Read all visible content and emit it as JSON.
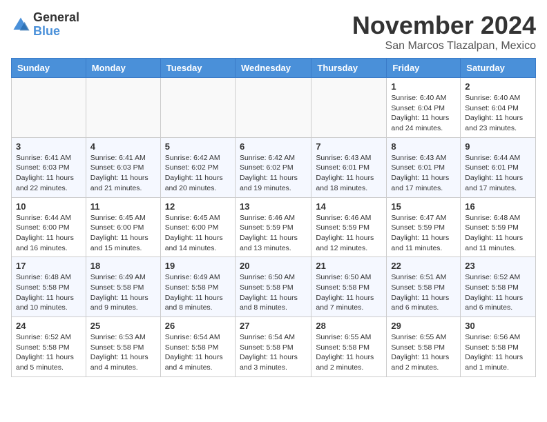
{
  "logo": {
    "general": "General",
    "blue": "Blue"
  },
  "title": "November 2024",
  "location": "San Marcos Tlazalpan, Mexico",
  "weekdays": [
    "Sunday",
    "Monday",
    "Tuesday",
    "Wednesday",
    "Thursday",
    "Friday",
    "Saturday"
  ],
  "weeks": [
    [
      {
        "day": "",
        "info": ""
      },
      {
        "day": "",
        "info": ""
      },
      {
        "day": "",
        "info": ""
      },
      {
        "day": "",
        "info": ""
      },
      {
        "day": "",
        "info": ""
      },
      {
        "day": "1",
        "info": "Sunrise: 6:40 AM\nSunset: 6:04 PM\nDaylight: 11 hours and 24 minutes."
      },
      {
        "day": "2",
        "info": "Sunrise: 6:40 AM\nSunset: 6:04 PM\nDaylight: 11 hours and 23 minutes."
      }
    ],
    [
      {
        "day": "3",
        "info": "Sunrise: 6:41 AM\nSunset: 6:03 PM\nDaylight: 11 hours and 22 minutes."
      },
      {
        "day": "4",
        "info": "Sunrise: 6:41 AM\nSunset: 6:03 PM\nDaylight: 11 hours and 21 minutes."
      },
      {
        "day": "5",
        "info": "Sunrise: 6:42 AM\nSunset: 6:02 PM\nDaylight: 11 hours and 20 minutes."
      },
      {
        "day": "6",
        "info": "Sunrise: 6:42 AM\nSunset: 6:02 PM\nDaylight: 11 hours and 19 minutes."
      },
      {
        "day": "7",
        "info": "Sunrise: 6:43 AM\nSunset: 6:01 PM\nDaylight: 11 hours and 18 minutes."
      },
      {
        "day": "8",
        "info": "Sunrise: 6:43 AM\nSunset: 6:01 PM\nDaylight: 11 hours and 17 minutes."
      },
      {
        "day": "9",
        "info": "Sunrise: 6:44 AM\nSunset: 6:01 PM\nDaylight: 11 hours and 17 minutes."
      }
    ],
    [
      {
        "day": "10",
        "info": "Sunrise: 6:44 AM\nSunset: 6:00 PM\nDaylight: 11 hours and 16 minutes."
      },
      {
        "day": "11",
        "info": "Sunrise: 6:45 AM\nSunset: 6:00 PM\nDaylight: 11 hours and 15 minutes."
      },
      {
        "day": "12",
        "info": "Sunrise: 6:45 AM\nSunset: 6:00 PM\nDaylight: 11 hours and 14 minutes."
      },
      {
        "day": "13",
        "info": "Sunrise: 6:46 AM\nSunset: 5:59 PM\nDaylight: 11 hours and 13 minutes."
      },
      {
        "day": "14",
        "info": "Sunrise: 6:46 AM\nSunset: 5:59 PM\nDaylight: 11 hours and 12 minutes."
      },
      {
        "day": "15",
        "info": "Sunrise: 6:47 AM\nSunset: 5:59 PM\nDaylight: 11 hours and 11 minutes."
      },
      {
        "day": "16",
        "info": "Sunrise: 6:48 AM\nSunset: 5:59 PM\nDaylight: 11 hours and 11 minutes."
      }
    ],
    [
      {
        "day": "17",
        "info": "Sunrise: 6:48 AM\nSunset: 5:58 PM\nDaylight: 11 hours and 10 minutes."
      },
      {
        "day": "18",
        "info": "Sunrise: 6:49 AM\nSunset: 5:58 PM\nDaylight: 11 hours and 9 minutes."
      },
      {
        "day": "19",
        "info": "Sunrise: 6:49 AM\nSunset: 5:58 PM\nDaylight: 11 hours and 8 minutes."
      },
      {
        "day": "20",
        "info": "Sunrise: 6:50 AM\nSunset: 5:58 PM\nDaylight: 11 hours and 8 minutes."
      },
      {
        "day": "21",
        "info": "Sunrise: 6:50 AM\nSunset: 5:58 PM\nDaylight: 11 hours and 7 minutes."
      },
      {
        "day": "22",
        "info": "Sunrise: 6:51 AM\nSunset: 5:58 PM\nDaylight: 11 hours and 6 minutes."
      },
      {
        "day": "23",
        "info": "Sunrise: 6:52 AM\nSunset: 5:58 PM\nDaylight: 11 hours and 6 minutes."
      }
    ],
    [
      {
        "day": "24",
        "info": "Sunrise: 6:52 AM\nSunset: 5:58 PM\nDaylight: 11 hours and 5 minutes."
      },
      {
        "day": "25",
        "info": "Sunrise: 6:53 AM\nSunset: 5:58 PM\nDaylight: 11 hours and 4 minutes."
      },
      {
        "day": "26",
        "info": "Sunrise: 6:54 AM\nSunset: 5:58 PM\nDaylight: 11 hours and 4 minutes."
      },
      {
        "day": "27",
        "info": "Sunrise: 6:54 AM\nSunset: 5:58 PM\nDaylight: 11 hours and 3 minutes."
      },
      {
        "day": "28",
        "info": "Sunrise: 6:55 AM\nSunset: 5:58 PM\nDaylight: 11 hours and 2 minutes."
      },
      {
        "day": "29",
        "info": "Sunrise: 6:55 AM\nSunset: 5:58 PM\nDaylight: 11 hours and 2 minutes."
      },
      {
        "day": "30",
        "info": "Sunrise: 6:56 AM\nSunset: 5:58 PM\nDaylight: 11 hours and 1 minute."
      }
    ]
  ]
}
